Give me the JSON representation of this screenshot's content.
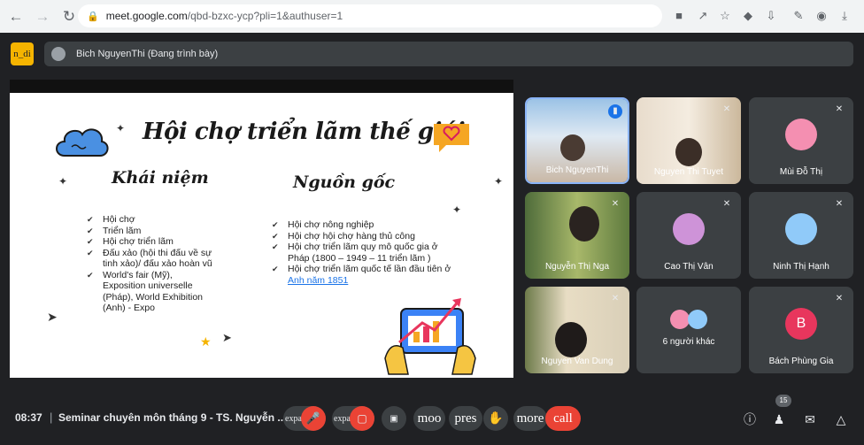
{
  "browser": {
    "url_host": "meet.google.com",
    "url_path": "/qbd-bzxc-ycp?pli=1&authuser=1",
    "icons": [
      "back-icon",
      "forward-icon",
      "reload-icon",
      "lock-icon",
      "camera-icon",
      "share-icon",
      "star-icon",
      "shield-icon",
      "download-page-icon",
      "extensions-icon",
      "profile-icon",
      "download-icon"
    ]
  },
  "header": {
    "logo_text": "n_di",
    "presenter_text": "Bich NguyenThi (Đang trình bày)"
  },
  "slide": {
    "title": "Hội chợ triển lãm thế giới",
    "left_heading": "Khái niệm",
    "right_heading": "Nguồn gốc",
    "left_items": [
      "Hội chợ",
      "Triển lãm",
      "Hội chợ triển lãm",
      "Đấu xảo (hội thi đấu về sự tinh xảo)/ đấu xảo hoàn vũ",
      "World's fair (Mỹ), Exposition universelle (Pháp), World Exhibition (Anh) - Expo"
    ],
    "right_items": [
      "Hội chợ nông nghiệp",
      "Hội chợ hội chợ hàng thủ công",
      "Hội chợ triển lãm quy mô quốc gia ở Pháp (1800 – 1949 – 11 triển lãm )"
    ],
    "right_last_prefix": "Hội chợ triển lãm quốc tế lần đầu tiên ở ",
    "right_last_link": "Anh năm 1851"
  },
  "participants": [
    {
      "name": "Bich NguyenThi",
      "type": "video",
      "speaking": true
    },
    {
      "name": "Nguyen Thi Tuyet",
      "type": "video"
    },
    {
      "name": "Mùi Đỗ Thị",
      "type": "avatar",
      "color": "#f48fb1"
    },
    {
      "name": "Nguyễn Thị Nga",
      "type": "video"
    },
    {
      "name": "Cao Thị Vân",
      "type": "avatar",
      "color": "#ce93d8"
    },
    {
      "name": "Ninh Thị Hạnh",
      "type": "avatar",
      "color": "#90caf9"
    },
    {
      "name": "Nguyen Van Dung",
      "type": "video"
    },
    {
      "name": "6 người khác",
      "type": "others"
    },
    {
      "name": "Bách Phùng Gia",
      "type": "letter",
      "letter": "B",
      "color": "#e8365d"
    }
  ],
  "footer": {
    "time": "08:37",
    "separator": "|",
    "meeting_title": "Seminar chuyên môn tháng 9 - TS. Nguyễn ...",
    "controls": {
      "mic_label": "expa",
      "cam_label": "expa",
      "mood_label": "moo",
      "present_label": "pres",
      "raise_label": "",
      "more_label": "more",
      "call_label": "call"
    },
    "people_count": "15"
  }
}
